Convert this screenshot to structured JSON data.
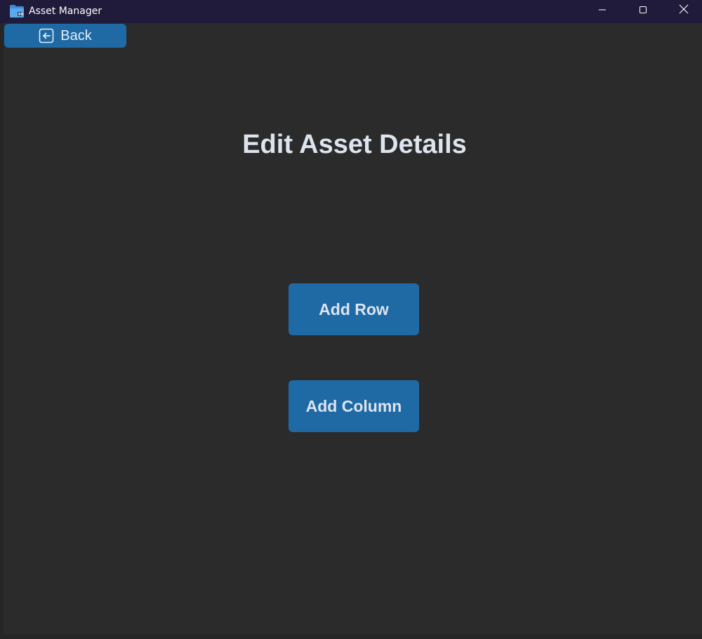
{
  "window": {
    "title": "Asset Manager",
    "app_icon": "folder-app-icon",
    "controls": {
      "minimize": "minimize-icon",
      "maximize": "maximize-icon",
      "close": "close-icon"
    }
  },
  "nav": {
    "back_label": "Back",
    "back_icon": "arrow-left-box-icon"
  },
  "main": {
    "title": "Edit Asset Details",
    "actions": [
      {
        "label": "Add Row"
      },
      {
        "label": "Add Column"
      }
    ]
  },
  "colors": {
    "titlebar": "#211b3b",
    "background": "#2b2b2b",
    "accent": "#1f6aa5",
    "text": "#dce4ee"
  }
}
